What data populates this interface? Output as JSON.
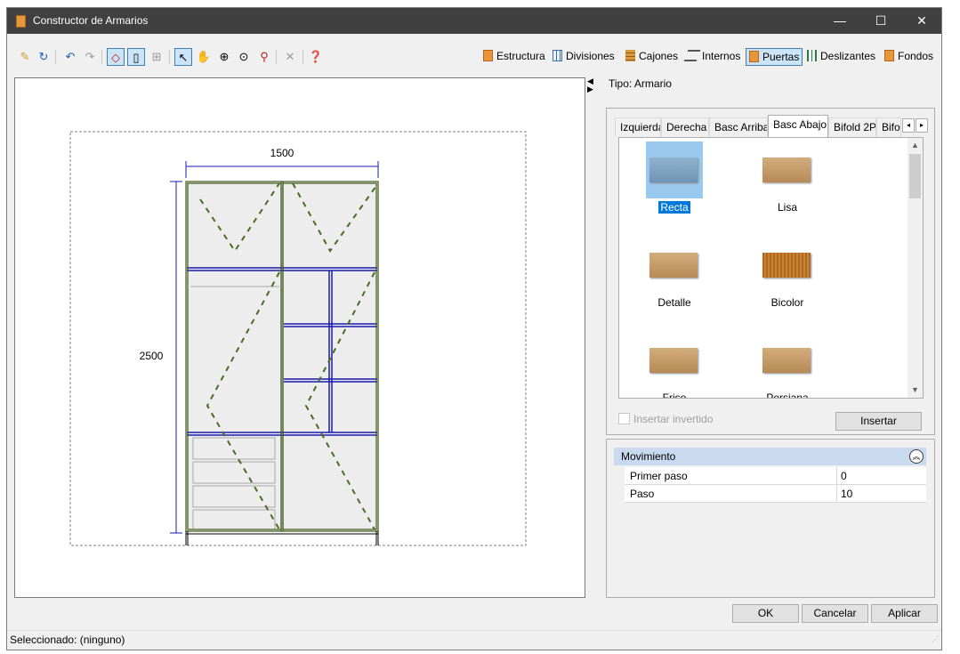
{
  "window": {
    "title": "Constructor de Armarios",
    "controls": {
      "minimize": "—",
      "maximize": "☐",
      "close": "✕"
    }
  },
  "toolbar": {
    "left_icons": [
      "new-icon",
      "refresh-icon",
      "undo-icon",
      "redo-icon",
      "draw-doors-icon",
      "door-outline-icon",
      "grid-icon",
      "pointer-icon",
      "hand-icon",
      "zoom-extents-icon",
      "zoom-window-icon",
      "zoom-icon",
      "delete-icon",
      "help-icon"
    ],
    "right_items": [
      {
        "label": "Estructura",
        "icon": "wardrobe-icon",
        "active": false
      },
      {
        "label": "Divisiones",
        "icon": "grid-icon",
        "active": false
      },
      {
        "label": "Cajones",
        "icon": "drawer-icon",
        "active": false
      },
      {
        "label": "Internos",
        "icon": "shelf-icon",
        "active": false
      },
      {
        "label": "Puertas",
        "icon": "door-icon",
        "active": true
      },
      {
        "label": "Deslizantes",
        "icon": "sliding-door-icon",
        "active": false
      },
      {
        "label": "Fondos",
        "icon": "back-panel-icon",
        "active": false
      }
    ]
  },
  "drawing": {
    "width_dim": "1500",
    "height_dim": "2500",
    "line_color": "#1a1ab0",
    "frame_color": "#3d5a1c"
  },
  "side": {
    "tipo_label": "Tipo: Armario"
  },
  "doors_tabs": [
    {
      "label": "Izquierda",
      "active": false
    },
    {
      "label": "Derecha",
      "active": false
    },
    {
      "label": "Basc Arriba",
      "active": false
    },
    {
      "label": "Basc Abajo",
      "active": true
    },
    {
      "label": "Bifold 2P",
      "active": false
    },
    {
      "label": "Bifold",
      "active": false
    }
  ],
  "tab_scroll": {
    "left": "◂",
    "right": "▸"
  },
  "gallery": {
    "items": [
      {
        "label": "Recta",
        "style": "blue",
        "selected": true
      },
      {
        "label": "Lisa",
        "style": "wood",
        "selected": false
      },
      {
        "label": "Detalle",
        "style": "wood",
        "selected": false
      },
      {
        "label": "Bicolor",
        "style": "dark",
        "selected": false
      },
      {
        "label": "Friso",
        "style": "wood",
        "selected": false
      },
      {
        "label": "Persiana",
        "style": "wood",
        "selected": false
      }
    ],
    "scroll_up": "▲",
    "scroll_down": "▼"
  },
  "insert": {
    "checkbox_label": "Insertar invertido",
    "checkbox_checked": false,
    "button_label": "Insertar"
  },
  "properties": {
    "group_title": "Movimiento",
    "collapse_glyph": "︽",
    "rows": [
      {
        "name": "Primer paso",
        "value": "0"
      },
      {
        "name": "Paso",
        "value": "10"
      }
    ]
  },
  "dialog_buttons": {
    "ok": "OK",
    "cancel": "Cancelar",
    "apply": "Aplicar"
  },
  "status": {
    "text": "Seleccionado: (ninguno)"
  }
}
